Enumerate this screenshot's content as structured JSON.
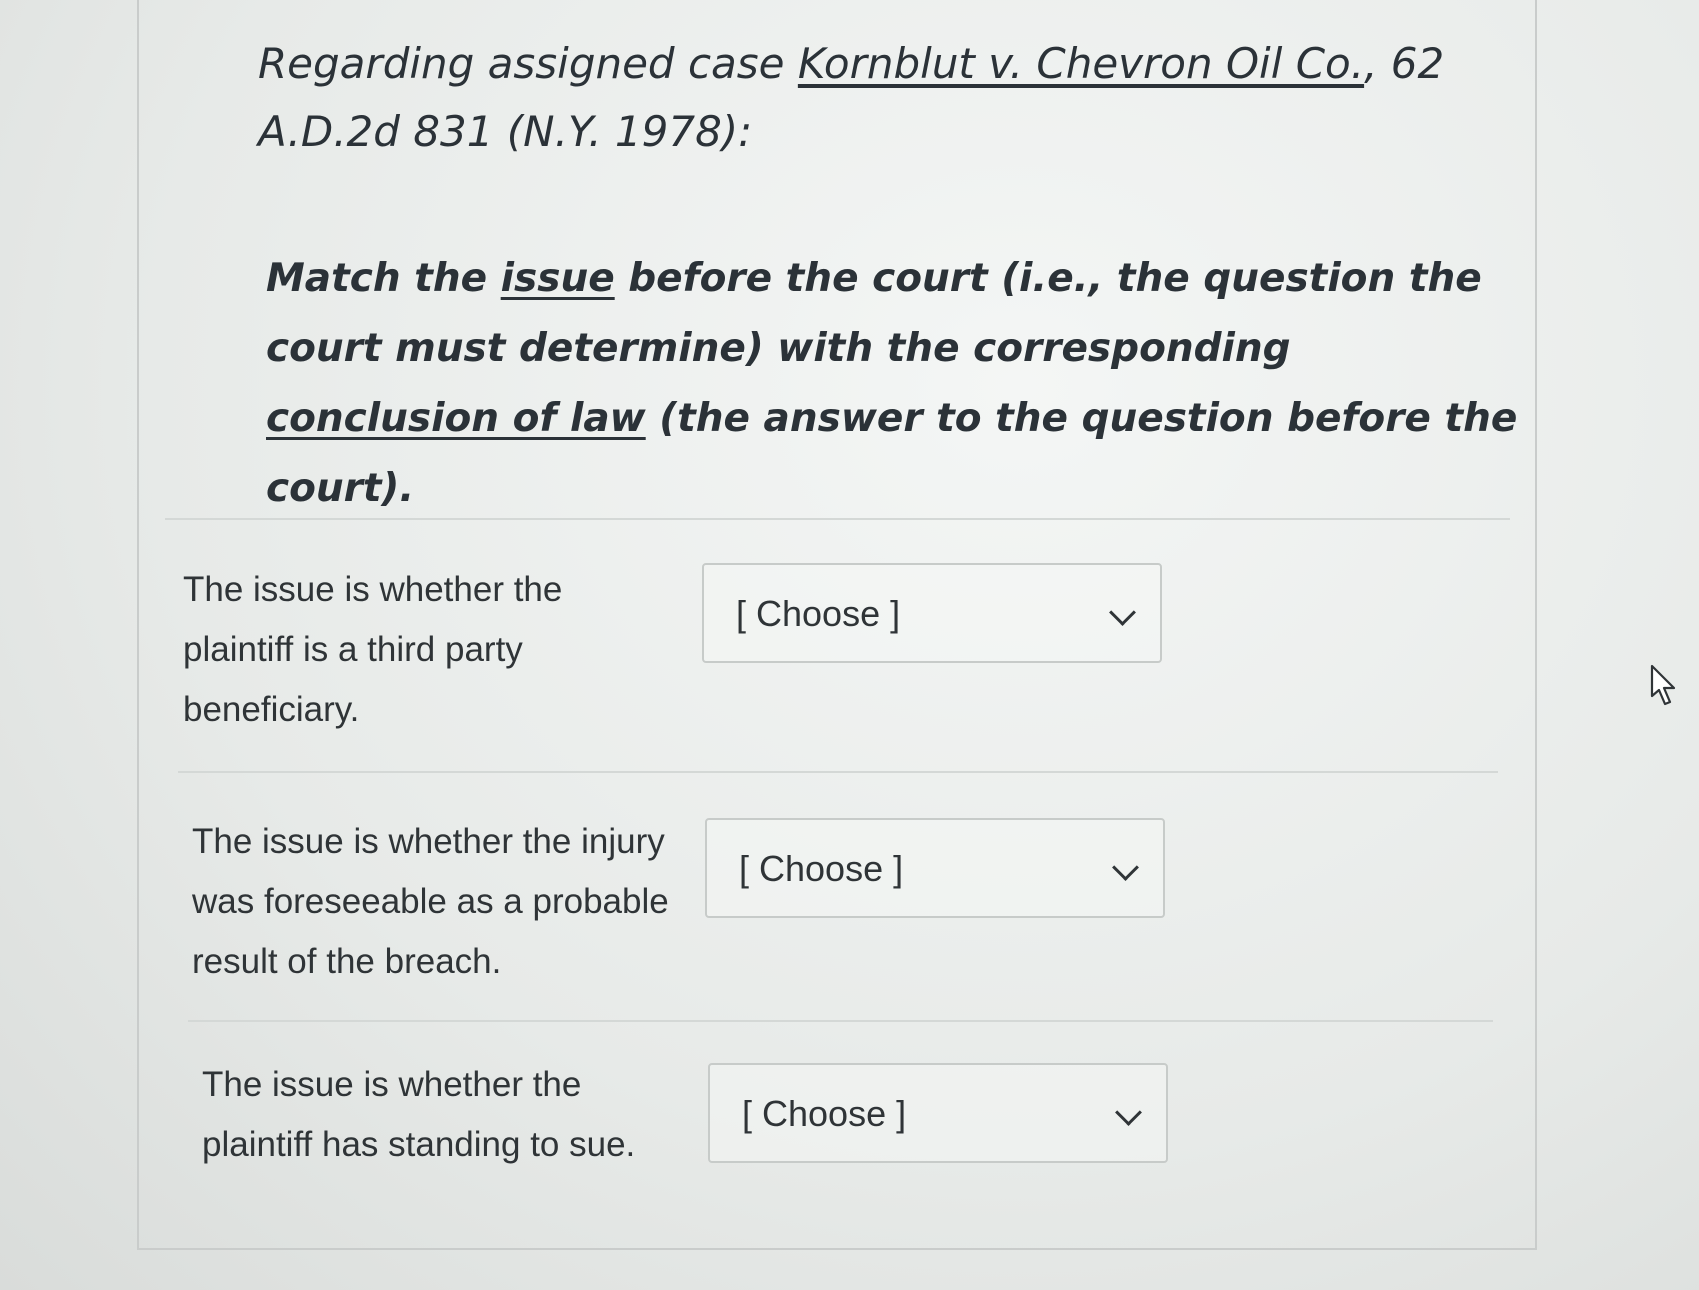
{
  "question": {
    "line1_prefix": "Regarding assigned case ",
    "case_name": "Kornblut v. Chevron Oil Co.",
    "line1_suffix": ", 62 A.D.2d 831 (N.Y. 1978):",
    "p2_a": "Match the ",
    "p2_issue": "issue",
    "p2_b": " before the court (i.e., the question the court must determine) with the corresponding ",
    "p2_conclusion": "conclusion of law",
    "p2_c": " (the answer to the question before the court)."
  },
  "rows": [
    {
      "issue_text": "The issue is whether the plaintiff is a third party beneficiary.",
      "select_value": "[ Choose ]"
    },
    {
      "issue_text": "The issue is whether the injury was foreseeable as a probable result of the breach.",
      "select_value": "[ Choose ]"
    },
    {
      "issue_text": "The issue is whether the plaintiff has standing to sue.",
      "select_value": "[ Choose ]"
    }
  ],
  "icons": {
    "dropdown": "chevron-down-icon",
    "pointer": "mouse-cursor-icon"
  }
}
